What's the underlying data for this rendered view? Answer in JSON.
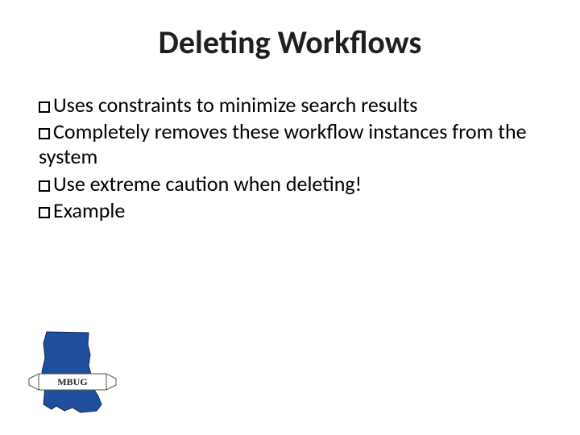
{
  "title": "Deleting Workflows",
  "bullets": [
    "Uses constraints to minimize search results",
    "Completely removes these workflow instances from the system",
    "Use extreme caution when deleting!",
    "Example"
  ],
  "logo": {
    "label": "MBUG",
    "state_fill": "#1f4e9c",
    "banner_fill": "#ffffff",
    "banner_stroke": "#555555"
  }
}
